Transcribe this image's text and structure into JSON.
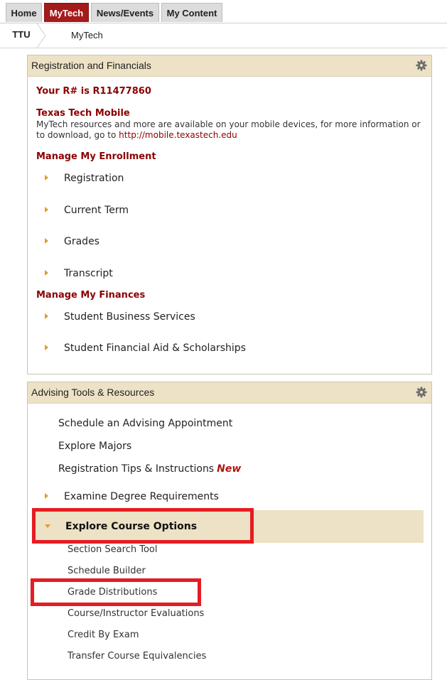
{
  "tabs": [
    {
      "label": "Home",
      "active": false
    },
    {
      "label": "MyTech",
      "active": true
    },
    {
      "label": "News/Events",
      "active": false
    },
    {
      "label": "My Content",
      "active": false
    }
  ],
  "breadcrumb": {
    "home": "TTU",
    "current": "MyTech"
  },
  "registration_panel": {
    "title": "Registration and Financials",
    "r_number": "Your R# is R11477860",
    "mobile_heading": "Texas Tech Mobile",
    "mobile_text": "MyTech resources and more are available on your mobile devices, for more information or to download, go to",
    "mobile_link": "http://mobile.texastech.edu",
    "enrollment_heading": "Manage My Enrollment",
    "enrollment_items": [
      "Registration",
      "Current Term",
      "Grades",
      "Transcript"
    ],
    "finances_heading": "Manage My Finances",
    "finances_items": [
      "Student Business Services",
      "Student Financial Aid & Scholarships"
    ]
  },
  "advising_panel": {
    "title": "Advising Tools & Resources",
    "links": [
      "Schedule an Advising Appointment",
      "Explore Majors",
      "Registration Tips & Instructions"
    ],
    "new_badge": "New",
    "degree_item": "Examine Degree Requirements",
    "expanded_item": "Explore Course Options",
    "sub_links": [
      "Section Search Tool",
      "Schedule Builder",
      "Grade Distributions",
      "Course/Instructor Evaluations",
      "Credit By Exam",
      "Transfer Course Equivalencies"
    ]
  },
  "colors": {
    "active_tab": "#a31b1b",
    "panel_header": "#ede2c5",
    "heading_red": "#8b0000",
    "bullet_orange": "#e39a2b",
    "highlight_red": "#e51c23"
  }
}
